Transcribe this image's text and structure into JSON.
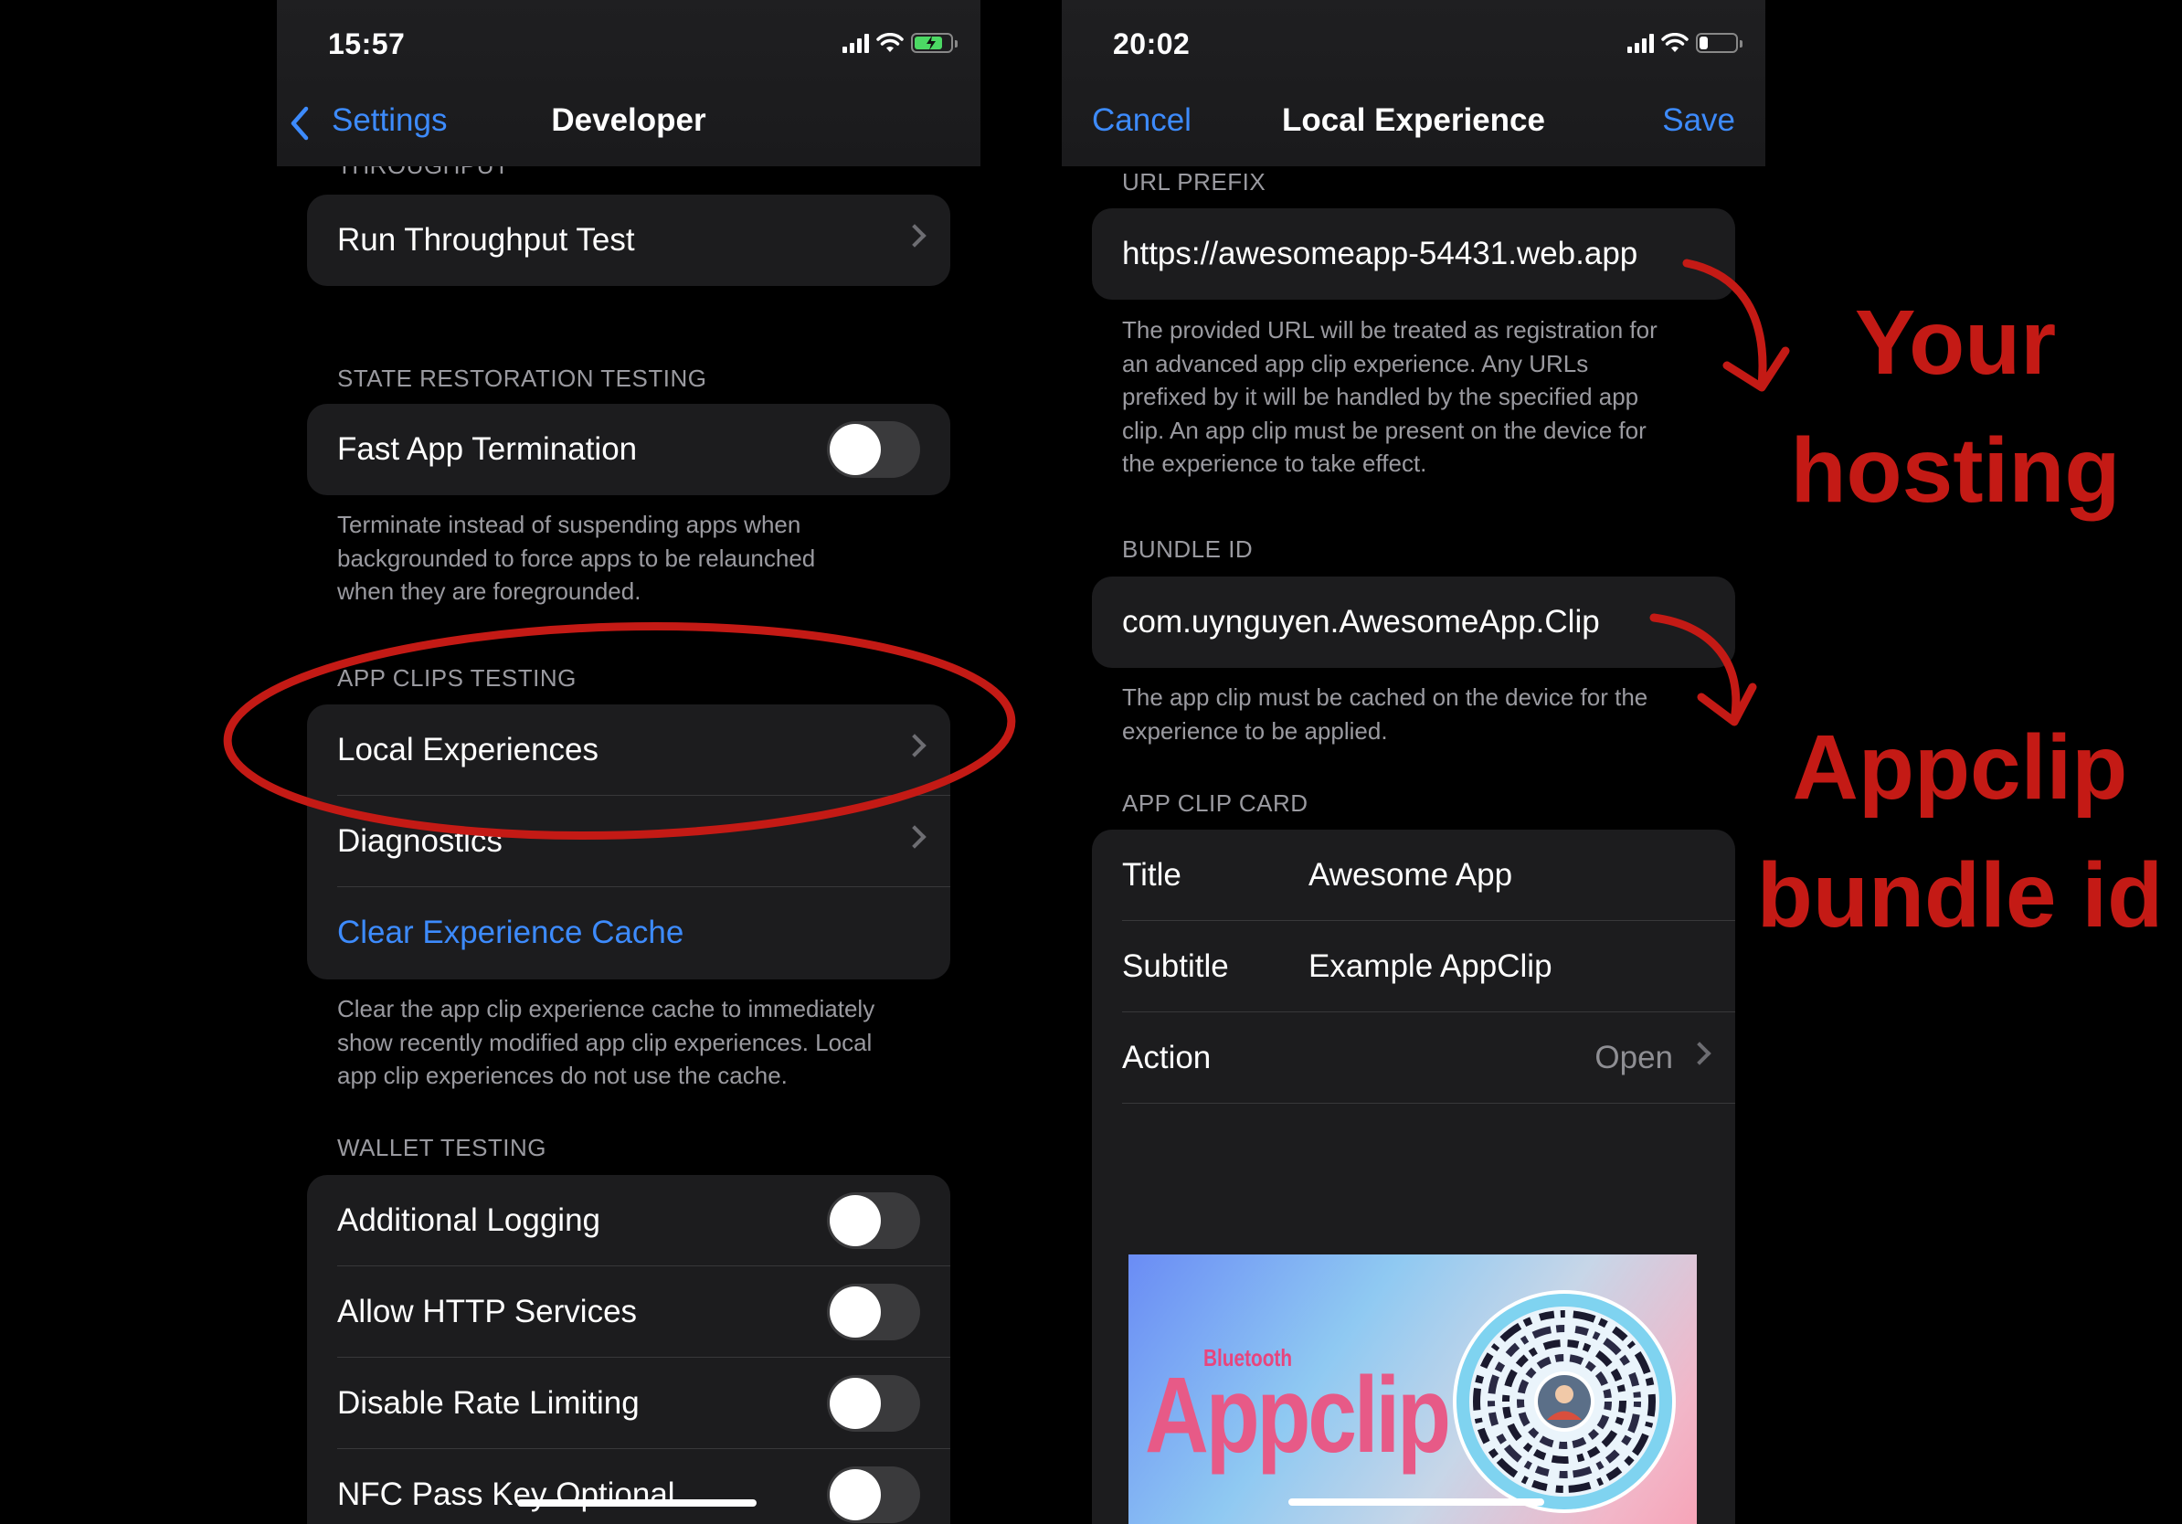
{
  "left_phone": {
    "status": {
      "time": "15:57"
    },
    "nav": {
      "back_label": "Settings",
      "title": "Developer"
    },
    "partial_header": "THROUGHPUT",
    "throughput_row": "Run Throughput Test",
    "state_restoration": {
      "header": "STATE RESTORATION TESTING",
      "row": "Fast App Termination",
      "toggle_on": false,
      "footer": [
        "Terminate instead of suspending apps when",
        "backgrounded to force apps to be relaunched",
        "when they are foregrounded."
      ]
    },
    "app_clips": {
      "header": "APP CLIPS TESTING",
      "rows": [
        "Local Experiences",
        "Diagnostics"
      ],
      "action": "Clear Experience Cache",
      "footer": [
        "Clear the app clip experience cache to immediately",
        "show recently modified app clip experiences. Local",
        "app clip experiences do not use the cache."
      ]
    },
    "wallet": {
      "header": "WALLET TESTING",
      "rows": [
        "Additional Logging",
        "Allow HTTP Services",
        "Disable Rate Limiting",
        "NFC Pass Key Optional"
      ]
    }
  },
  "right_phone": {
    "status": {
      "time": "20:02"
    },
    "nav": {
      "cancel_label": "Cancel",
      "title": "Local Experience",
      "save_label": "Save"
    },
    "url_prefix": {
      "header": "URL PREFIX",
      "value": "https://awesomeapp-54431.web.app",
      "footer": [
        "The provided URL will be treated as registration for",
        "an advanced app clip experience. Any URLs",
        "prefixed by it will be handled by the specified app",
        "clip. An app clip must be present on the device for",
        "the experience to take effect."
      ]
    },
    "bundle_id": {
      "header": "BUNDLE ID",
      "value": "com.uynguyen.AwesomeApp.Clip",
      "footer": [
        "The app clip must be cached on the device for the",
        "experience to be applied."
      ]
    },
    "app_clip_card": {
      "header": "APP CLIP CARD",
      "title_label": "Title",
      "title_value": "Awesome App",
      "subtitle_label": "Subtitle",
      "subtitle_value": "Example AppClip",
      "action_label": "Action",
      "action_value": "Open",
      "image_small_text": "Bluetooth",
      "image_big_text": "Appclip"
    }
  },
  "annotations": {
    "hosting": [
      "Your",
      "hosting"
    ],
    "bundle": [
      "Appclip",
      "bundle id"
    ]
  },
  "colors": {
    "accent_blue": "#3d8bfd",
    "annotation_red": "#c41a15",
    "card_bg": "#1c1c1e"
  }
}
